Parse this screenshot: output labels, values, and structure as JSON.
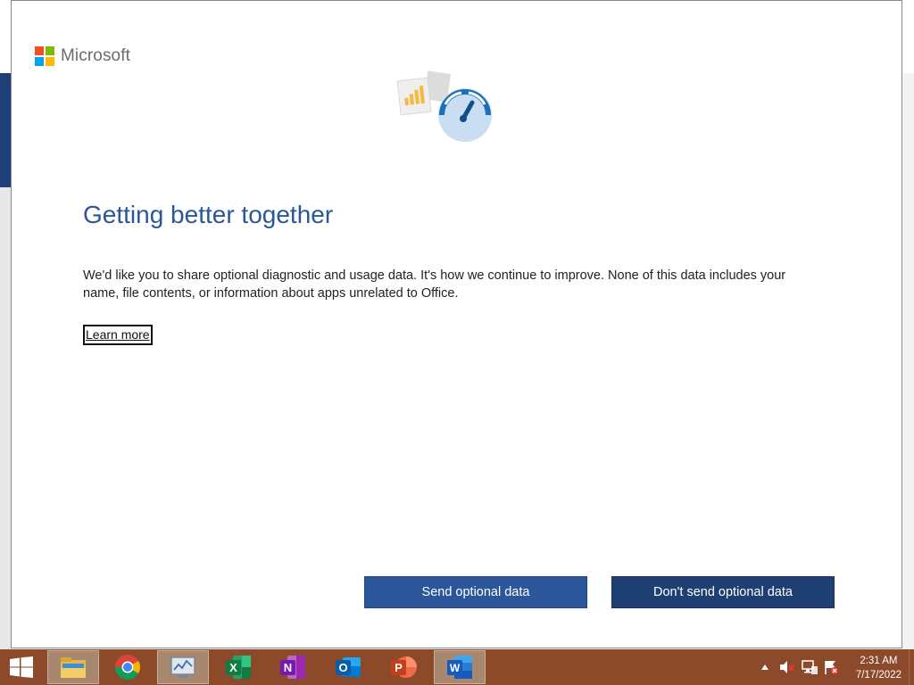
{
  "dialog": {
    "brand": "Microsoft",
    "title": "Getting better together",
    "body": "We'd like you to share optional diagnostic and usage data. It's how we continue to improve. None of this data includes your name, file contents, or information about apps unrelated to Office.",
    "learn_more": "Learn more",
    "buttons": {
      "send": "Send optional data",
      "dont_send": "Don't send optional data"
    }
  },
  "taskbar": {
    "apps": [
      {
        "name": "file-explorer",
        "icon": "folder-icon"
      },
      {
        "name": "chrome",
        "icon": "chrome-icon"
      },
      {
        "name": "performance-monitor",
        "icon": "monitor-icon"
      },
      {
        "name": "excel",
        "icon": "excel-icon",
        "letter": "X"
      },
      {
        "name": "onenote",
        "icon": "onenote-icon",
        "letter": "N"
      },
      {
        "name": "outlook",
        "icon": "outlook-icon",
        "letter": "O"
      },
      {
        "name": "powerpoint",
        "icon": "powerpoint-icon",
        "letter": "P"
      },
      {
        "name": "word",
        "icon": "word-icon",
        "letter": "W"
      }
    ],
    "clock": {
      "time": "2:31 AM",
      "date": "7/17/2022"
    }
  },
  "colors": {
    "accent": "#2b579a",
    "button_send": "#2b579a",
    "button_dont_send": "#1e3f72",
    "taskbar": "#8c4a2b",
    "ms_red": "#f25022",
    "ms_green": "#7fba00",
    "ms_blue": "#00a4ef",
    "ms_yellow": "#ffb900"
  }
}
